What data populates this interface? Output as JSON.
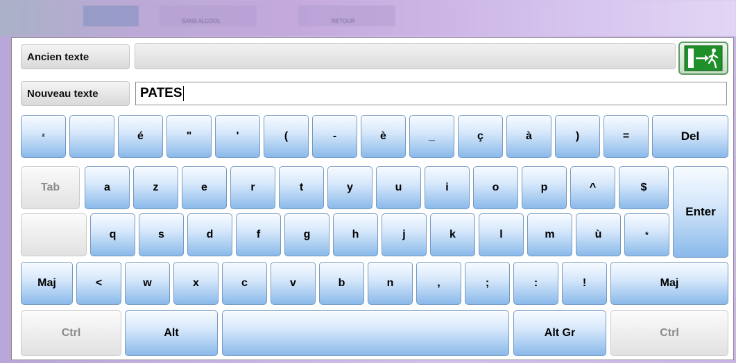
{
  "titlebar": {
    "text1": "SANS ALCOOL",
    "text2": "RETOUR"
  },
  "labels": {
    "old_text": "Ancien texte",
    "new_text": "Nouveau texte"
  },
  "fields": {
    "old_value": "",
    "new_value": "PATES"
  },
  "keys": {
    "r1": [
      "²",
      "",
      "é",
      "\"",
      "'",
      "(",
      "-",
      "è",
      "_",
      "ç",
      "à",
      ")",
      "=",
      "Del"
    ],
    "r2": [
      "Tab",
      "a",
      "z",
      "e",
      "r",
      "t",
      "y",
      "u",
      "i",
      "o",
      "p",
      "^",
      "$",
      "Enter"
    ],
    "r3": [
      "",
      "q",
      "s",
      "d",
      "f",
      "g",
      "h",
      "j",
      "k",
      "l",
      "m",
      "ù",
      "*"
    ],
    "r4": [
      "Maj",
      "<",
      "w",
      "x",
      "c",
      "v",
      "b",
      "n",
      ",",
      ";",
      ":",
      "!",
      "Maj"
    ],
    "r5": [
      "Ctrl",
      "Alt",
      "",
      "Alt Gr",
      "Ctrl"
    ]
  },
  "icons": {
    "exit": "exit-door-icon"
  }
}
